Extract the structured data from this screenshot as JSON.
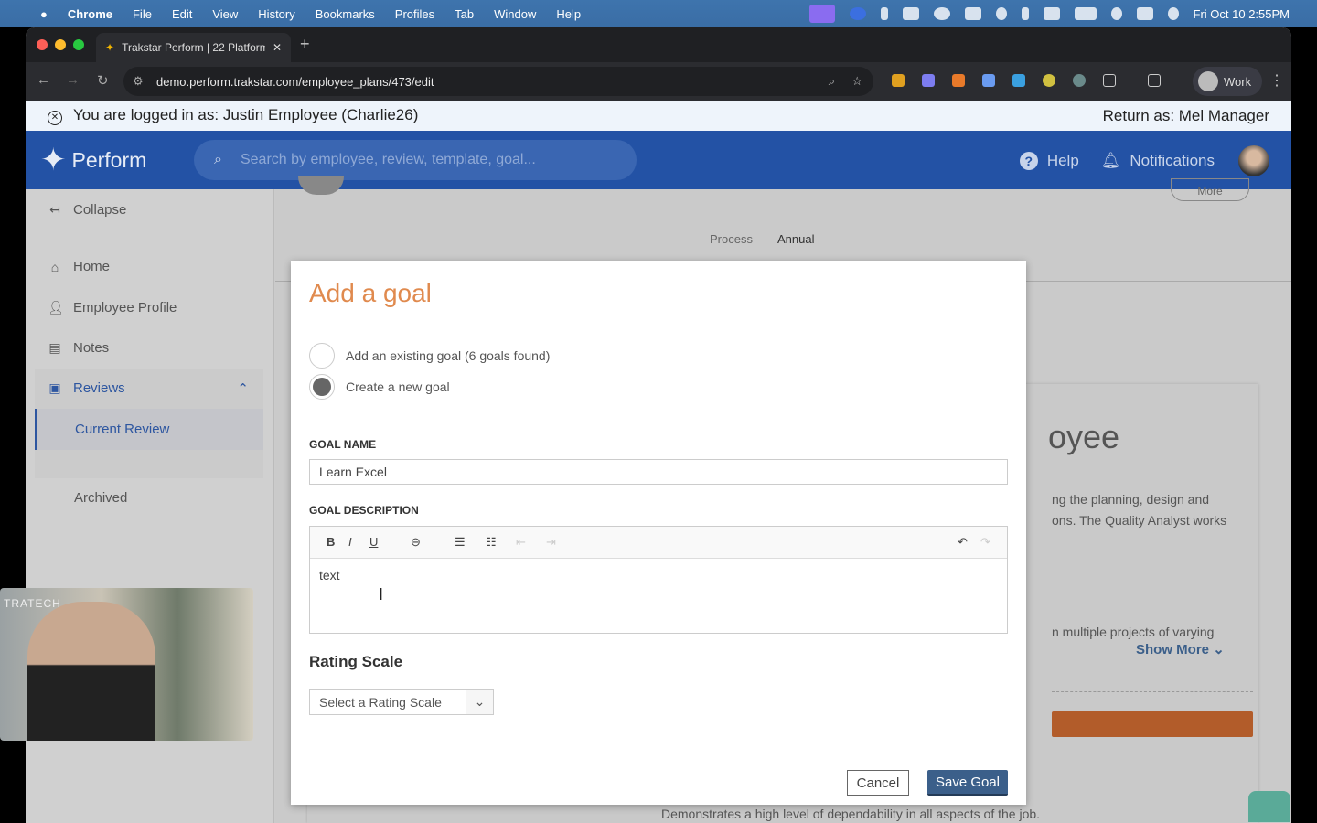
{
  "menubar": {
    "items": [
      "Chrome",
      "File",
      "Edit",
      "View",
      "History",
      "Bookmarks",
      "Profiles",
      "Tab",
      "Window",
      "Help"
    ],
    "clock": "Fri Oct 10  2:55PM"
  },
  "browser": {
    "tab_title": "Trakstar Perform | 22 Platform",
    "url": "demo.perform.trakstar.com/employee_plans/473/edit",
    "profile": "Work"
  },
  "banner": {
    "logged_in": "You are logged in as: Justin Employee (Charlie26)",
    "return": "Return as: Mel Manager"
  },
  "header": {
    "logo": "Perform",
    "search_placeholder": "Search by employee, review, template, goal...",
    "help": "Help",
    "notifications": "Notifications"
  },
  "sidebar": {
    "collapse": "Collapse",
    "items": [
      "Home",
      "Employee Profile",
      "Notes",
      "Reviews"
    ],
    "sub": [
      "Current Review",
      "Archived"
    ]
  },
  "background": {
    "process_label": "Process",
    "process_value": "Annual",
    "more": "More",
    "heading": "oyee",
    "desc1": "ng the planning, design and",
    "desc2": "ons. The Quality Analyst works",
    "desc3": "n multiple projects of varying",
    "show_more": "Show More",
    "bullet": "Demonstrates a high level of dependability in all aspects of the job."
  },
  "modal": {
    "title": "Add a goal",
    "option_existing": "Add an existing goal (6 goals found)",
    "option_new": "Create a new goal",
    "selected": "new",
    "goal_name_label": "GOAL NAME",
    "goal_name": "Learn Excel",
    "goal_desc_label": "GOAL DESCRIPTION",
    "goal_desc": "text",
    "rating_label": "Rating Scale",
    "rating_placeholder": "Select a Rating Scale",
    "cancel": "Cancel",
    "save": "Save Goal"
  },
  "video": {
    "sign": "TRATECH"
  },
  "colors": {
    "brand": "#2352a5",
    "accent": "#e08a4e",
    "save": "#3b5f8a"
  }
}
